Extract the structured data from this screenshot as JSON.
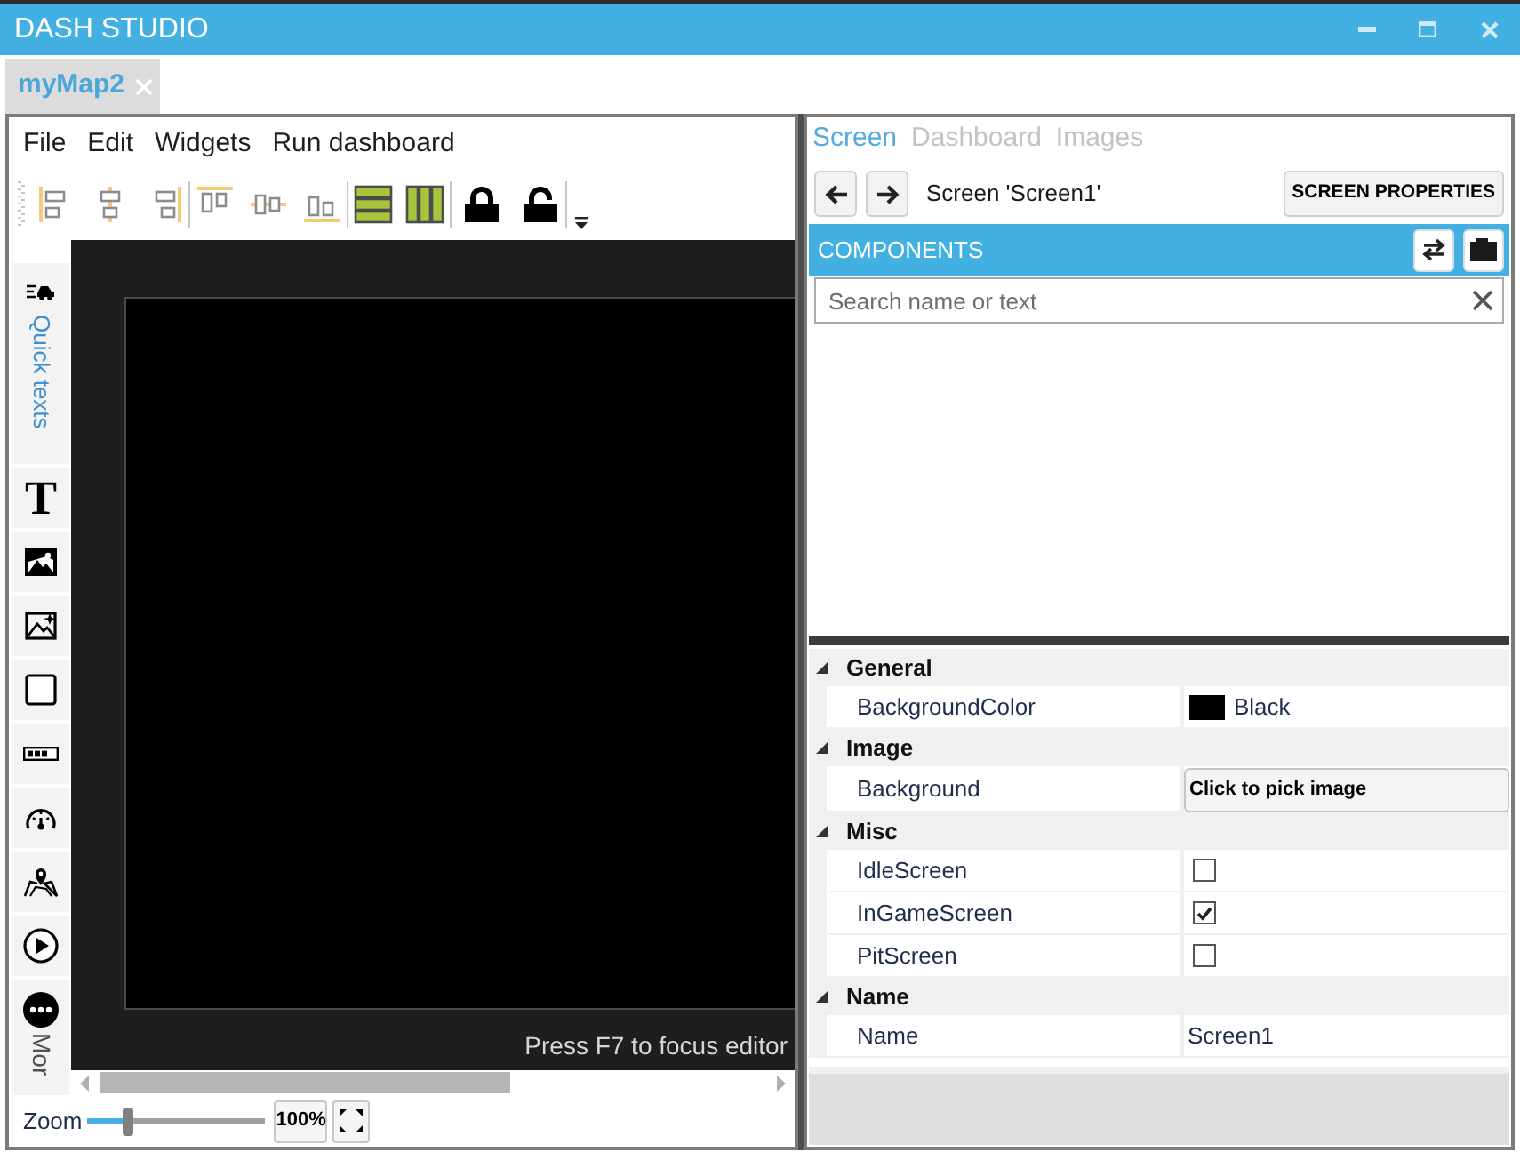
{
  "window": {
    "title": "DASH STUDIO"
  },
  "document_tabs": [
    {
      "label": "myMap2",
      "selected": true
    }
  ],
  "menu": [
    "File",
    "Edit",
    "Widgets",
    "Run dashboard"
  ],
  "widget_palette": {
    "quick_texts": "Quick texts",
    "text_tool_glyph": "T",
    "more": "Mor"
  },
  "editor": {
    "hint": "Press F7 to focus editor"
  },
  "zoom": {
    "label": "Zoom",
    "level": 0.23,
    "reading": "100%"
  },
  "side_tabs": [
    {
      "label": "Screen",
      "selected": true
    },
    {
      "label": "Dashboard",
      "selected": false
    },
    {
      "label": "Images",
      "selected": false
    }
  ],
  "screen_nav": {
    "title": "Screen 'Screen1'",
    "properties_button": "SCREEN PROPERTIES"
  },
  "components": {
    "title": "COMPONENTS",
    "search": {
      "placeholder": "Search name or text"
    }
  },
  "properties": [
    {
      "group": "General",
      "expanded": true,
      "rows": [
        {
          "kind": "color",
          "name": "BackgroundColor",
          "value": "Black",
          "color": "#000000"
        }
      ]
    },
    {
      "group": "Image",
      "expanded": true,
      "rows": [
        {
          "kind": "button",
          "name": "Background",
          "value": "Click to pick image"
        }
      ]
    },
    {
      "group": "Misc",
      "expanded": true,
      "rows": [
        {
          "kind": "checkbox",
          "name": "IdleScreen",
          "checked": false
        },
        {
          "kind": "checkbox",
          "name": "InGameScreen",
          "checked": true
        },
        {
          "kind": "checkbox",
          "name": "PitScreen",
          "checked": false
        }
      ]
    },
    {
      "group": "Name",
      "expanded": true,
      "rows": [
        {
          "kind": "text",
          "name": "Name",
          "value": "Screen1"
        }
      ]
    }
  ]
}
